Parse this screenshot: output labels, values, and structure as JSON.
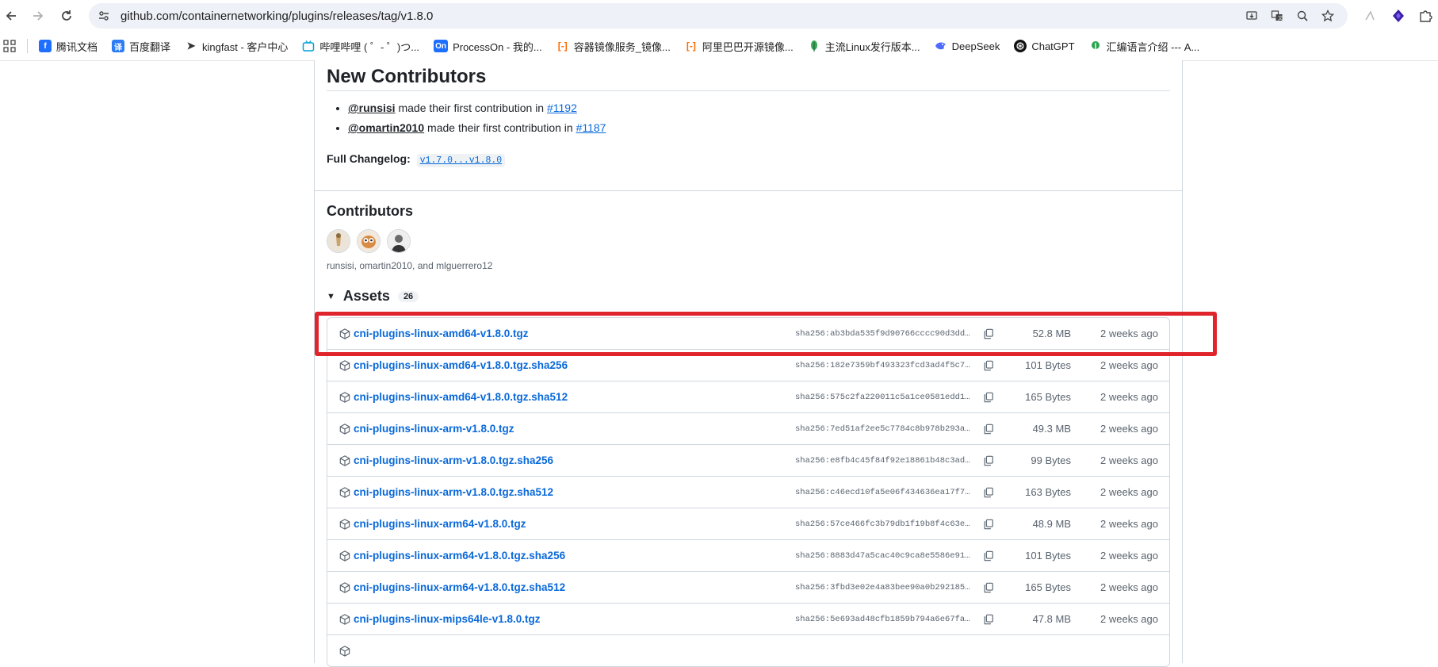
{
  "browser": {
    "url": "github.com/containernetworking/plugins/releases/tag/v1.8.0",
    "bookmarks": [
      {
        "label": "腾讯文档",
        "icon": "tencent-docs-icon",
        "color": "#1e6fff"
      },
      {
        "label": "百度翻译",
        "icon": "baidu-translate-icon",
        "color": "#2c7cf6"
      },
      {
        "label": "kingfast - 客户中心",
        "icon": "cursor-icon",
        "color": "#333333"
      },
      {
        "label": "哔哩哔哩 ( ゜- ゜)つ...",
        "icon": "bilibili-icon",
        "color": "#00a1d6"
      },
      {
        "label": "ProcessOn - 我的...",
        "icon": "processon-icon",
        "color": "#1e6fff"
      },
      {
        "label": "容器镜像服务_镜像...",
        "icon": "aliyun-icon",
        "color": "#ff6a00"
      },
      {
        "label": "阿里巴巴开源镜像...",
        "icon": "aliyun-icon",
        "color": "#ff6a00"
      },
      {
        "label": "主流Linux发行版本...",
        "icon": "leaf-icon",
        "color": "#3aa757"
      },
      {
        "label": "DeepSeek",
        "icon": "deepseek-icon",
        "color": "#4d6bfe"
      },
      {
        "label": "ChatGPT",
        "icon": "chatgpt-icon",
        "color": "#111111"
      },
      {
        "label": "汇编语言介绍 --- A...",
        "icon": "leaf-icon",
        "color": "#2aa44f"
      }
    ]
  },
  "new_contributors": {
    "title": "New Contributors",
    "items": [
      {
        "user": "@runsisi",
        "text": "made their first contribution in",
        "pr": "#1192"
      },
      {
        "user": "@omartin2010",
        "text": "made their first contribution in",
        "pr": "#1187"
      }
    ],
    "changelog_label": "Full Changelog:",
    "changelog_link": "v1.7.0...v1.8.0"
  },
  "contributors": {
    "title": "Contributors",
    "names": "runsisi, omartin2010, and mlguerrero12"
  },
  "assets": {
    "title": "Assets",
    "count": "26",
    "rows": [
      {
        "name": "cni-plugins-linux-amd64-v1.8.0.tgz",
        "sha": "sha256:ab3bda535f9d90766cccc90d3dddb",
        "size": "52.8 MB",
        "date": "2 weeks ago"
      },
      {
        "name": "cni-plugins-linux-amd64-v1.8.0.tgz.sha256",
        "sha": "sha256:182e7359bf493323fcd3ad4f5c768",
        "size": "101 Bytes",
        "date": "2 weeks ago"
      },
      {
        "name": "cni-plugins-linux-amd64-v1.8.0.tgz.sha512",
        "sha": "sha256:575c2fa220011c5a1ce0581edd123",
        "size": "165 Bytes",
        "date": "2 weeks ago"
      },
      {
        "name": "cni-plugins-linux-arm-v1.8.0.tgz",
        "sha": "sha256:7ed51af2ee5c7784c8b978b293ad1",
        "size": "49.3 MB",
        "date": "2 weeks ago"
      },
      {
        "name": "cni-plugins-linux-arm-v1.8.0.tgz.sha256",
        "sha": "sha256:e8fb4c45f84f92e18861b48c3ad35",
        "size": "99 Bytes",
        "date": "2 weeks ago"
      },
      {
        "name": "cni-plugins-linux-arm-v1.8.0.tgz.sha512",
        "sha": "sha256:c46ecd10fa5e06f434636ea17f791",
        "size": "163 Bytes",
        "date": "2 weeks ago"
      },
      {
        "name": "cni-plugins-linux-arm64-v1.8.0.tgz",
        "sha": "sha256:57ce466fc3b79db1f19b8f4c63e07",
        "size": "48.9 MB",
        "date": "2 weeks ago"
      },
      {
        "name": "cni-plugins-linux-arm64-v1.8.0.tgz.sha256",
        "sha": "sha256:8883d47a5cac40c9ca8e5586e91ef",
        "size": "101 Bytes",
        "date": "2 weeks ago"
      },
      {
        "name": "cni-plugins-linux-arm64-v1.8.0.tgz.sha512",
        "sha": "sha256:3fbd3e02e4a83bee90a0b2921857b",
        "size": "165 Bytes",
        "date": "2 weeks ago"
      },
      {
        "name": "cni-plugins-linux-mips64le-v1.8.0.tgz",
        "sha": "sha256:5e693ad48cfb1859b794a6e67fa20",
        "size": "47.8 MB",
        "date": "2 weeks ago"
      },
      {
        "name": "",
        "sha": "",
        "size": "",
        "date": ""
      }
    ]
  },
  "highlight_color": "#e0242c",
  "link_color": "#0969da"
}
